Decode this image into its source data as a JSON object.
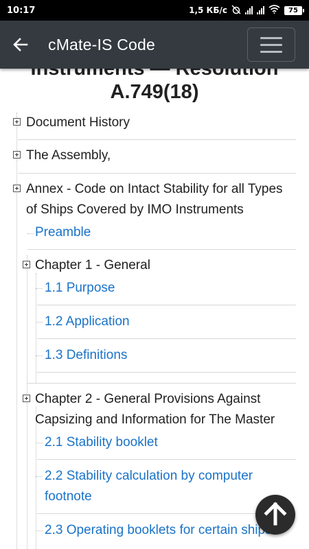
{
  "status_bar": {
    "time": "10:17",
    "network_speed": "1,5 КБ/с",
    "battery": "75",
    "icons": [
      "alarm-off-icon",
      "signal-icon",
      "signal-icon",
      "wifi-icon",
      "battery-icon"
    ]
  },
  "app_bar": {
    "title": "cMate-IS Code",
    "back_icon": "arrow-left-icon",
    "menu_icon": "hamburger-menu-icon"
  },
  "document": {
    "title_line1": "Instruments — Resolution",
    "title_line2": "A.749(18)"
  },
  "tree": {
    "document_history": "Document History",
    "assembly": "The Assembly,",
    "annex_line1": "Annex - Code on Intact Stability for all Types",
    "annex_line2": "of Ships Covered by IMO Instruments",
    "preamble": "Preamble",
    "chapter1": "Chapter 1 - General",
    "ch1_items": [
      "1.1 Purpose",
      "1.2 Application",
      "1.3 Definitions"
    ],
    "chapter2_line1": "Chapter 2 - General Provisions Against",
    "chapter2_line2": "Capsizing and Information for The Master",
    "ch2_items": [
      "2.1 Stability booklet",
      "2.2 Stability calculation by computer",
      "footnote",
      "2.3 Operating booklets for certain ships"
    ]
  },
  "fab": {
    "icon": "arrow-up-icon"
  },
  "colors": {
    "appbar": "#343a40",
    "link": "#1a73c8",
    "statusbar": "#000000"
  }
}
